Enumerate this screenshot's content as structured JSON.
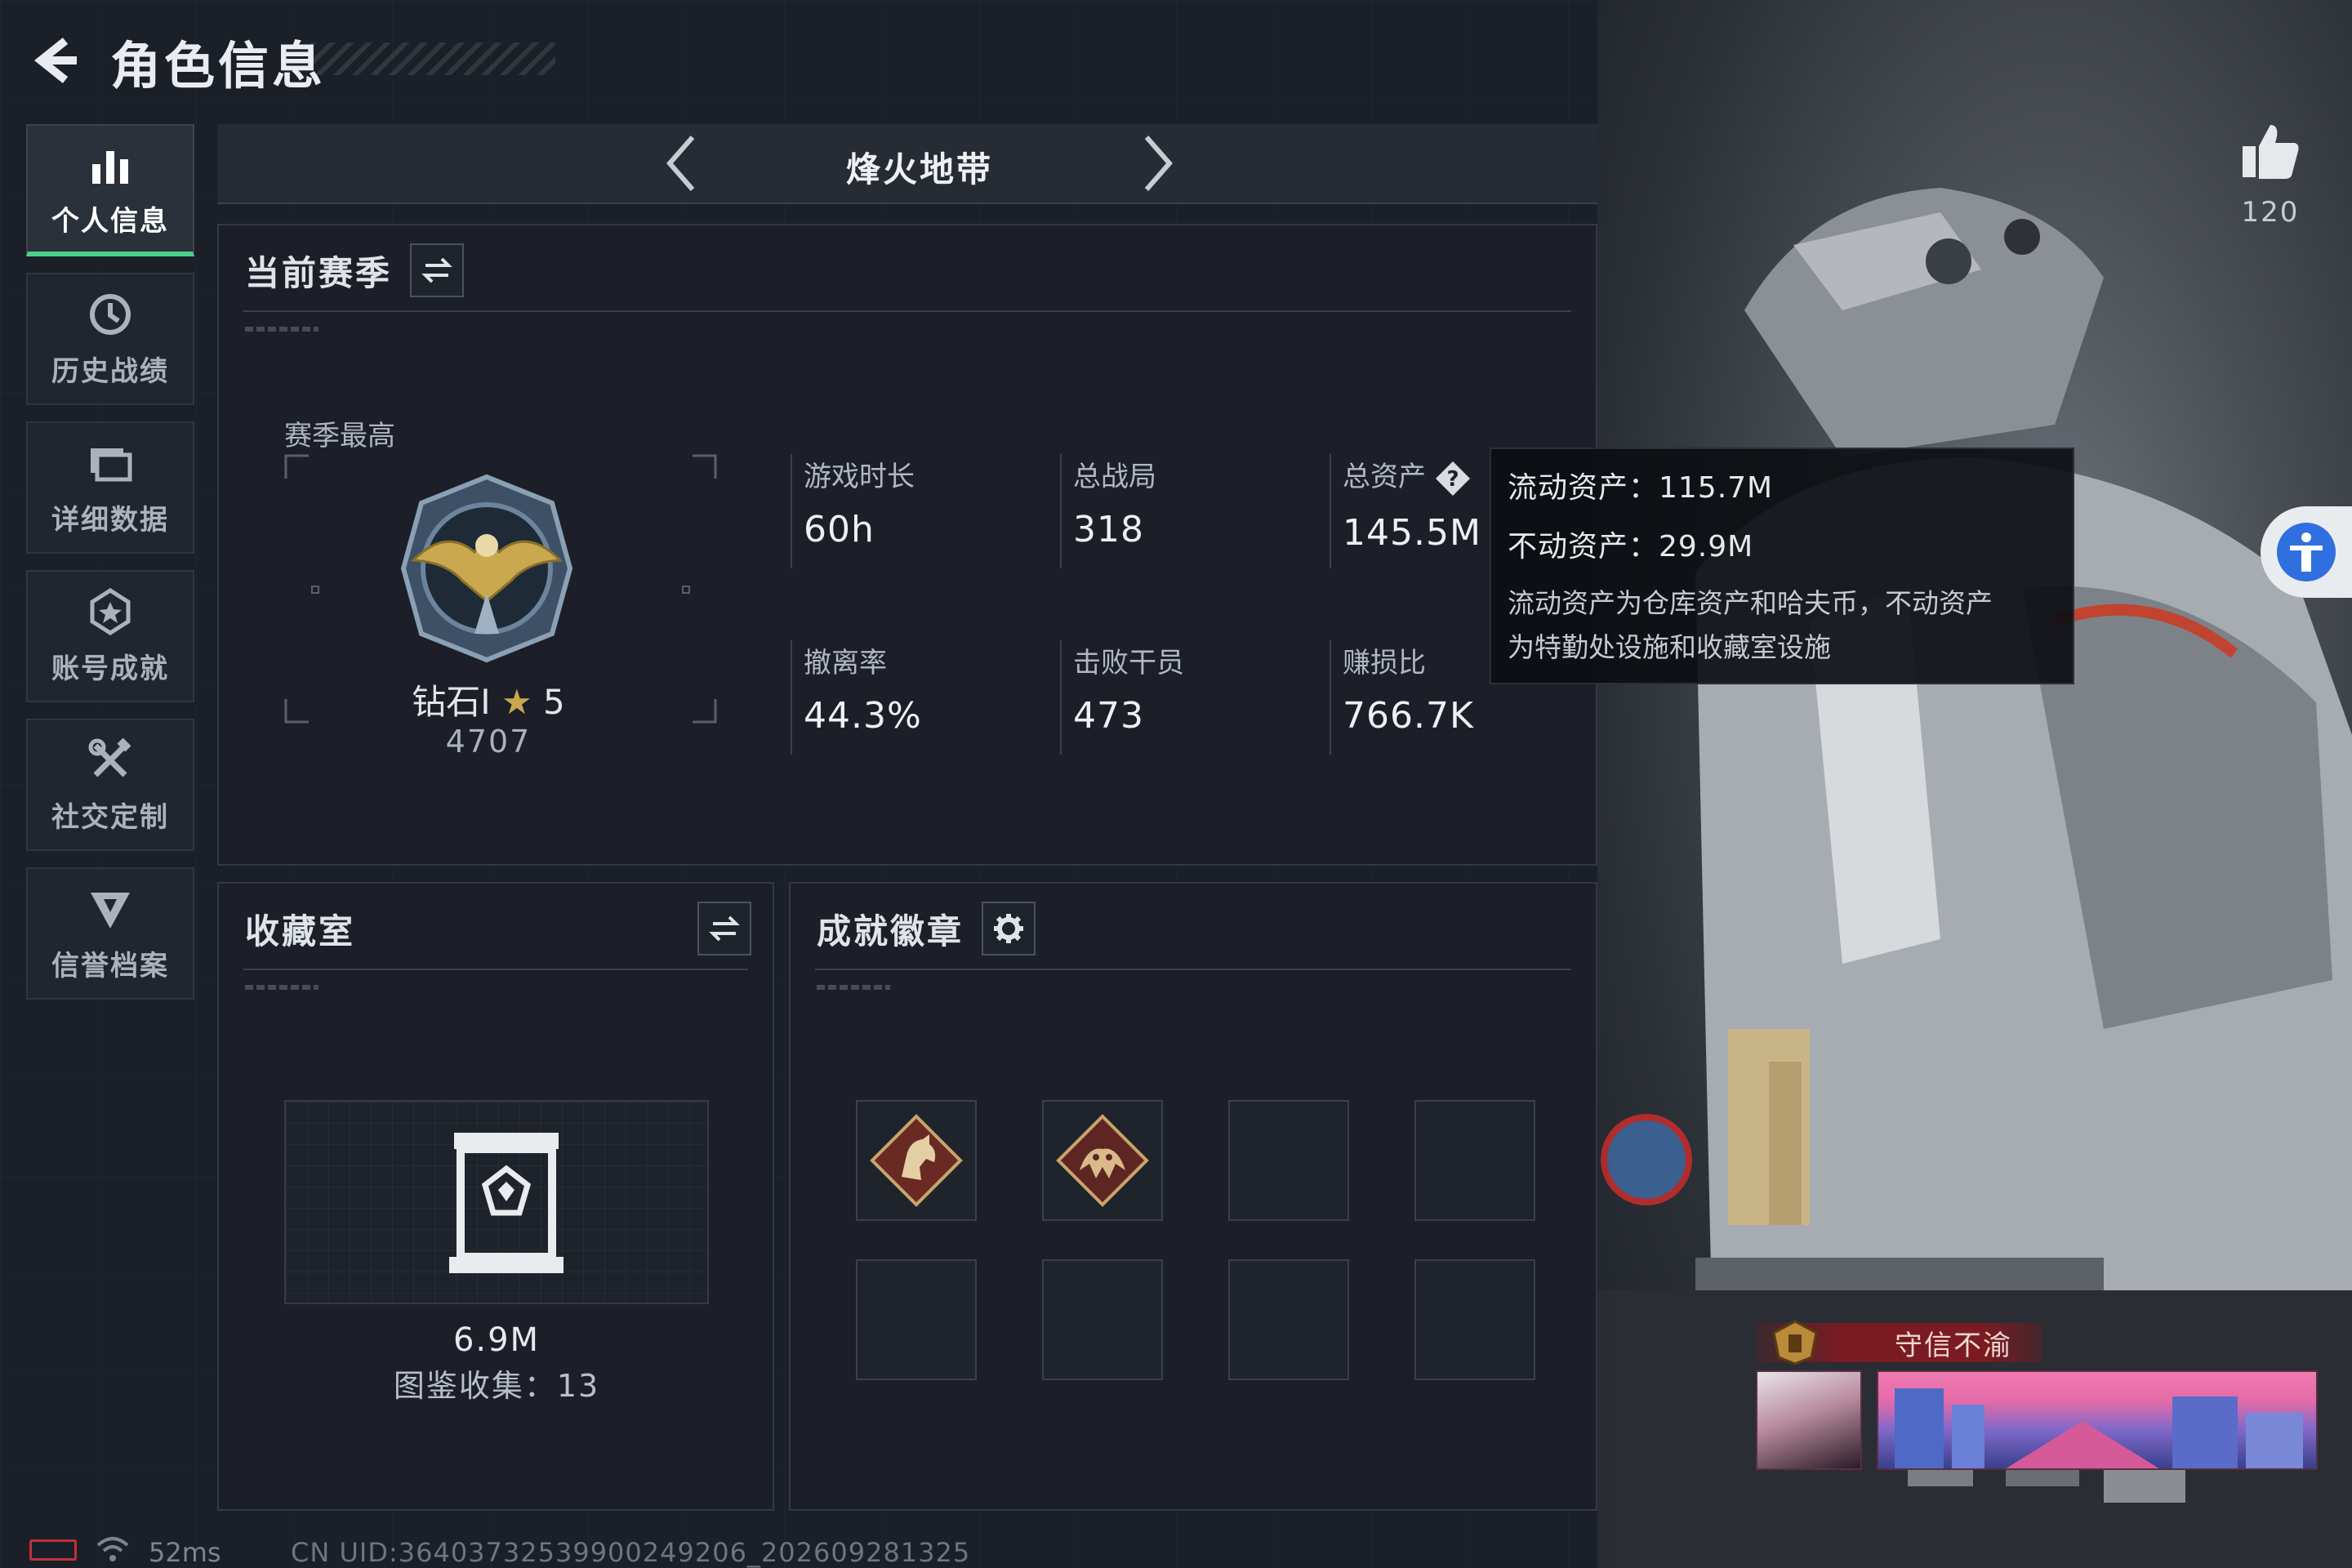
{
  "header": {
    "title": "角色信息"
  },
  "sidebar": {
    "items": [
      {
        "label": "个人信息",
        "icon": "bar-chart-icon",
        "active": true
      },
      {
        "label": "历史战绩",
        "icon": "history-clock-icon"
      },
      {
        "label": "详细数据",
        "icon": "folder-data-icon"
      },
      {
        "label": "账号成就",
        "icon": "achievement-star-icon"
      },
      {
        "label": "社交定制",
        "icon": "tools-wrench-icon"
      },
      {
        "label": "信誉档案",
        "icon": "credibility-badge-icon"
      }
    ]
  },
  "mode": {
    "title": "烽火地带"
  },
  "season": {
    "title": "当前赛季",
    "best_label": "赛季最高",
    "rank_name": "钻石Ⅰ",
    "rank_stars": "5",
    "rank_score": "4707",
    "stats": {
      "playtime": {
        "label": "游戏时长",
        "value": "60h"
      },
      "matches": {
        "label": "总战局",
        "value": "318"
      },
      "assets": {
        "label": "总资产",
        "value": "145.5M"
      },
      "extract_rate": {
        "label": "撤离率",
        "value": "44.3%"
      },
      "kills": {
        "label": "击败干员",
        "value": "473"
      },
      "profit_ratio": {
        "label": "赚损比",
        "value": "766.7K"
      }
    }
  },
  "tooltip": {
    "liquid": "流动资产：115.7M",
    "fixed": "不动资产：29.9M",
    "note_line1": "流动资产为仓库资产和哈夫币，不动资产",
    "note_line2": "为特勤处设施和收藏室设施"
  },
  "collection": {
    "title": "收藏室",
    "value": "6.9M",
    "count": "图鉴收集：13"
  },
  "badges": {
    "title": "成就徽章",
    "slots": [
      "horse-badge-icon",
      "dragon-badge-icon",
      "",
      "",
      "",
      "",
      "",
      ""
    ]
  },
  "profile": {
    "likes": "120",
    "title_tag": "守信不渝"
  },
  "footer": {
    "ping": "52ms",
    "uid": "CN UID:3640373253990024​9206_202609281325"
  },
  "colors": {
    "accent_green": "#4bd08a",
    "badge_gold": "#c9a84f",
    "title_tag_red": "#7a1b22",
    "battery_red": "#c0313a"
  }
}
